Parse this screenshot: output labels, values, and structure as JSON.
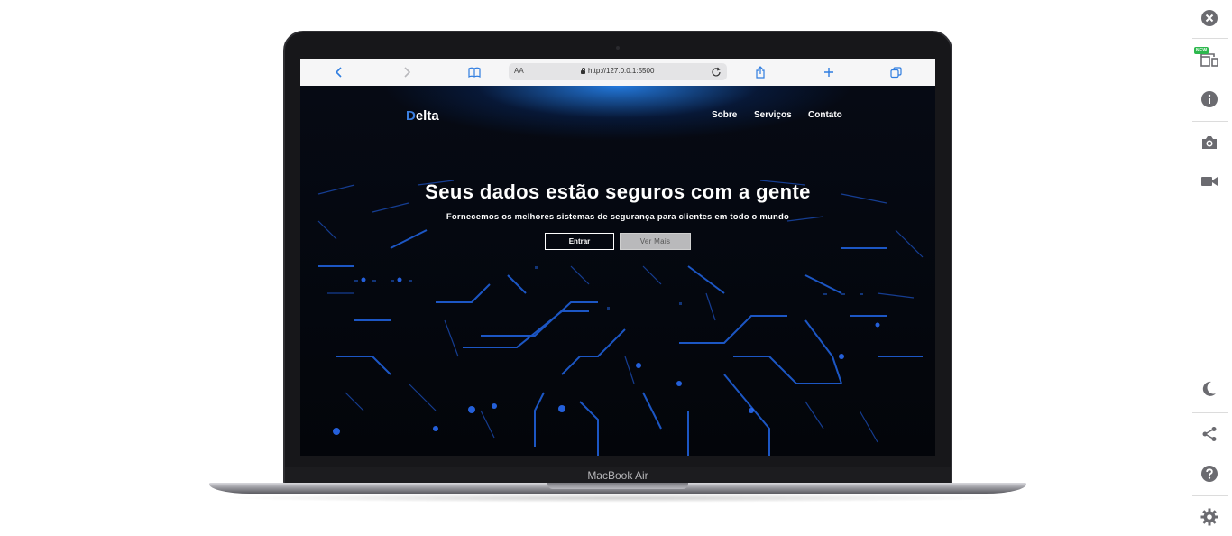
{
  "device": {
    "label": "MacBook Air"
  },
  "browser": {
    "url_aa": "AA",
    "url": "http://127.0.0.1:5500",
    "icons": [
      "back-icon",
      "forward-icon",
      "bookmarks-icon",
      "reload-icon",
      "share-icon",
      "new-tab-icon",
      "tabs-icon"
    ]
  },
  "site": {
    "logo_first": "D",
    "logo_rest": "elta",
    "nav": [
      "Sobre",
      "Serviços",
      "Contato"
    ],
    "hero_title": "Seus dados estão seguros com a gente",
    "hero_subtitle": "Fornecemos os melhores sistemas de segurança para clientes em todo o mundo",
    "primary_button": "Entrar",
    "secondary_button": "Ver Mais",
    "accent_color": "#3b7fe0"
  },
  "toolbar": {
    "new_badge": "NEW",
    "icons": [
      "close-icon",
      "responsive-devices-icon",
      "info-icon",
      "camera-icon",
      "video-icon",
      "dark-mode-icon",
      "share-icon",
      "help-icon",
      "settings-icon"
    ]
  }
}
